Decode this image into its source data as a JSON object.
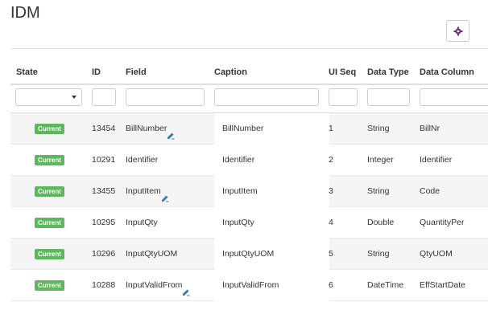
{
  "page": {
    "title": "IDM"
  },
  "toolbar": {
    "settings_icon": "gear-icon"
  },
  "columns": [
    "State",
    "ID",
    "Field",
    "Caption",
    "UI Seq",
    "Data Type",
    "Data Column"
  ],
  "rows": [
    {
      "state": "Current",
      "id": "13454",
      "field": "BillNumber",
      "caption": "BillNumber",
      "seq": "1",
      "type": "String",
      "column": "BillNr",
      "edit": true
    },
    {
      "state": "Current",
      "id": "10291",
      "field": "Identifier",
      "caption": "Identifier",
      "seq": "2",
      "type": "Integer",
      "column": "Identifier",
      "edit": false
    },
    {
      "state": "Current",
      "id": "13455",
      "field": "InputItem",
      "caption": "InputItem",
      "seq": "3",
      "type": "String",
      "column": "Code",
      "edit": true
    },
    {
      "state": "Current",
      "id": "10295",
      "field": "InputQty",
      "caption": "InputQty",
      "seq": "4",
      "type": "Double",
      "column": "QuantityPer",
      "edit": false
    },
    {
      "state": "Current",
      "id": "10296",
      "field": "InputQtyUOM",
      "caption": "InputQtyUOM",
      "seq": "5",
      "type": "String",
      "column": "QtyUOM",
      "edit": false
    },
    {
      "state": "Current",
      "id": "10288",
      "field": "InputValidFrom",
      "caption": "InputValidFrom",
      "seq": "6",
      "type": "DateTime",
      "column": "EffStartDate",
      "edit": true
    }
  ],
  "colors": {
    "badge": "#5cb85c",
    "link": "#337ab7",
    "gear": "#6b2d7a"
  }
}
